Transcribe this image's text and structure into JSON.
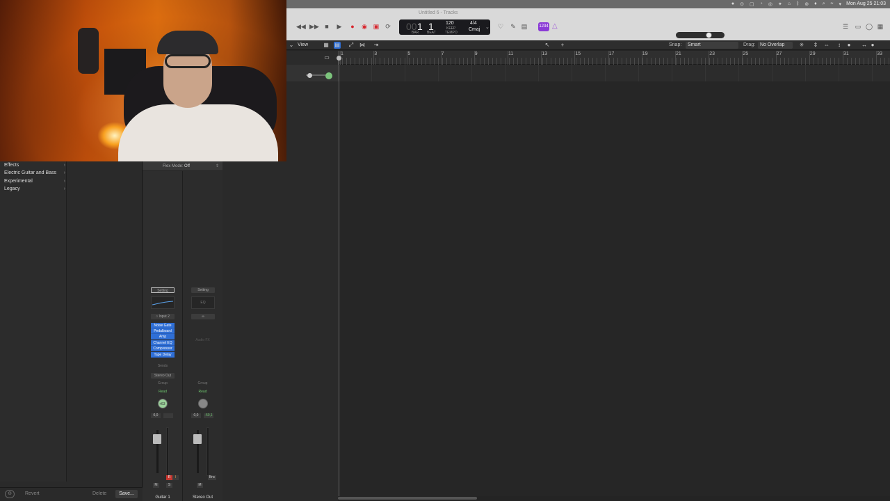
{
  "menubar": {
    "icons": [
      "●",
      "⊙",
      "▢",
      "◔",
      "◎",
      "✦",
      "⌂",
      "ᛒ",
      "⊚",
      "♦",
      "⌕",
      "≈",
      "▾"
    ],
    "clock": "Mon Aug 25 21:03"
  },
  "window": {
    "title": "Untitled 6 - Tracks"
  },
  "transport": {
    "rewind": "◀◀",
    "forward": "▶▶",
    "stop": "■",
    "play": "▶",
    "record": "●",
    "lcd": {
      "bar": "1",
      "beat": "1",
      "bar_label": "BAR",
      "beat_label": "BEAT",
      "tempo": "120",
      "keep_label": "KEEP",
      "tempo_label": "TEMPO",
      "signature": "4/4",
      "key": "Cmaj"
    },
    "count_in": "1234",
    "accent": "#8b3bd6",
    "master_volume": 0.7
  },
  "toolbar": {
    "view": "View",
    "snap_label": "Snap:",
    "snap_value": "Smart",
    "drag_label": "Drag:",
    "drag_value": "No Overlap"
  },
  "ruler": {
    "bars": [
      "1",
      "3",
      "5",
      "7",
      "9",
      "11",
      "13",
      "15",
      "17",
      "19",
      "21",
      "23",
      "25",
      "27",
      "29",
      "31",
      "33"
    ]
  },
  "library": {
    "items": [
      {
        "label": "Effects"
      },
      {
        "label": "Electric Guitar and Bass"
      },
      {
        "label": "Experimental"
      },
      {
        "label": "Legacy"
      }
    ],
    "footer": {
      "revert": "Revert",
      "delete": "Delete",
      "save": "Save..."
    }
  },
  "inspector": {
    "flex_label": "Flex Mode:",
    "flex_value": "Off",
    "strip1": {
      "setting": "Setting",
      "input": "Input 2",
      "plugins": [
        "Noise Gate",
        "Pedalboard",
        "Amp",
        "Channel EQ",
        "Compressor",
        "Tape Delay"
      ],
      "sends": "Sends",
      "output": "Stereo Out",
      "group": "Group",
      "automation": "Read",
      "pan": "+63",
      "volume": "0,0",
      "record": "R",
      "input_mon": "I",
      "mute": "M",
      "solo": "S",
      "name": "Guitar 1"
    },
    "strip2": {
      "setting": "Setting",
      "eq": "EQ",
      "link": "∞",
      "audio_fx": "Audio FX",
      "group": "Group",
      "automation": "Read",
      "volume": "0,0",
      "peak": "-50,1",
      "bounce": "Bnc",
      "mute": "M",
      "name": "Stereo Out"
    }
  }
}
